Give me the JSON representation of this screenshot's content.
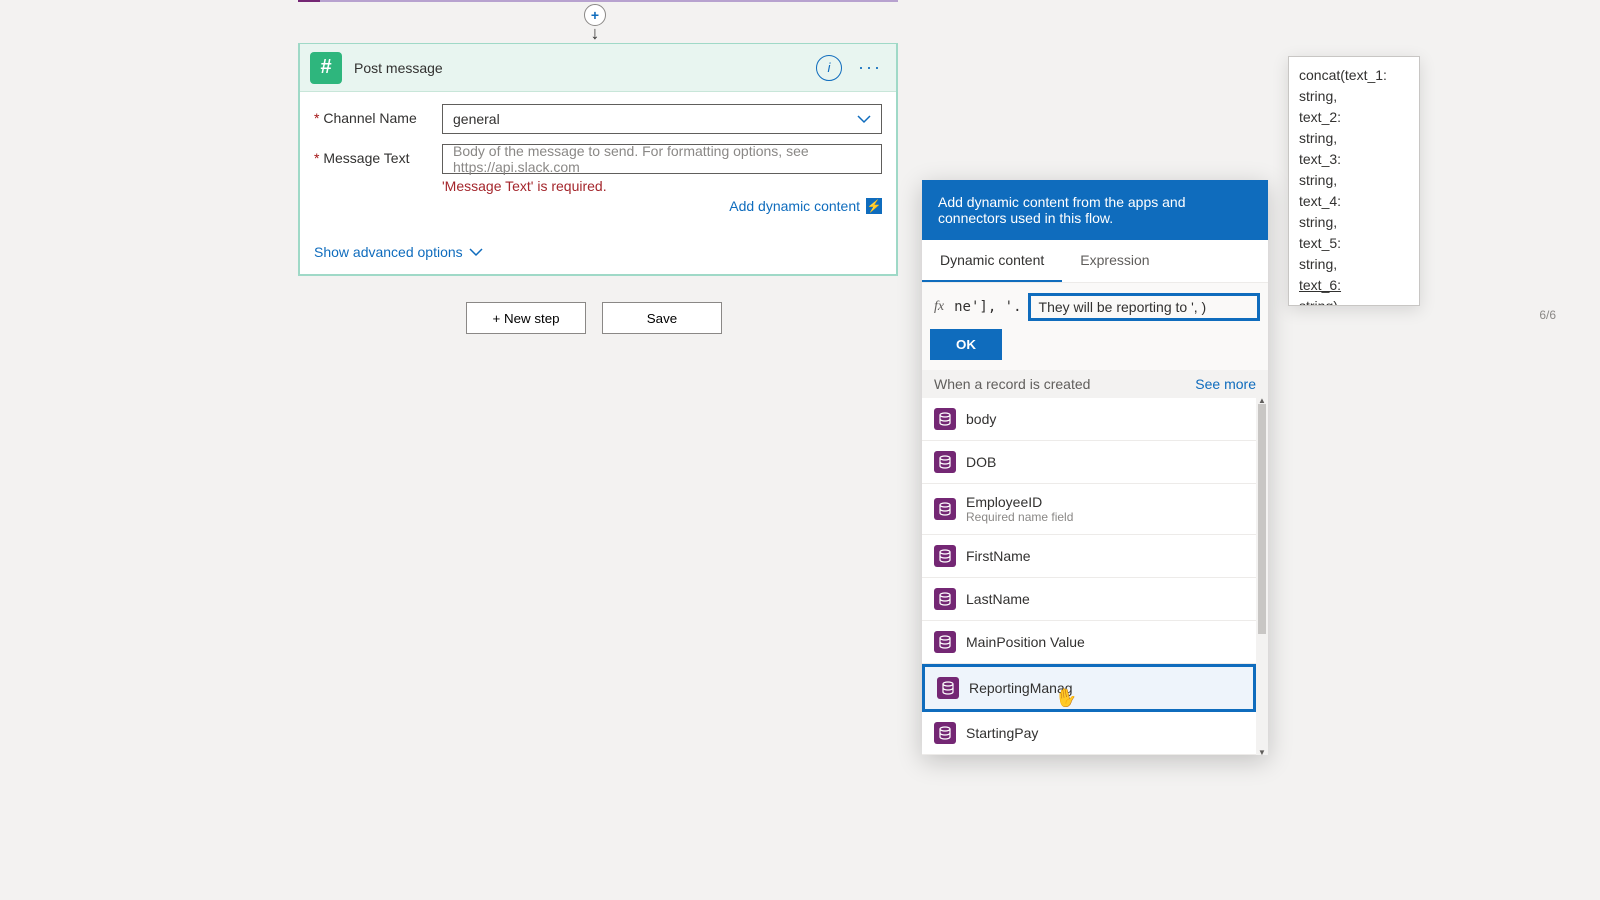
{
  "top": {
    "plus_label": "+"
  },
  "card": {
    "title": "Post message",
    "info_label": "i",
    "more_label": "···",
    "fields": {
      "channel_label": "Channel Name",
      "channel_value": "general",
      "messagetext_label": "Message Text",
      "messagetext_placeholder": "Body of the message to send. For formatting options, see https://api.slack.com",
      "messagetext_error": "'Message Text' is required."
    },
    "add_dynamic_label": "Add dynamic content",
    "show_advanced_label": "Show advanced options"
  },
  "buttons": {
    "new_step": "+ New step",
    "save": "Save"
  },
  "panel": {
    "header": "Add dynamic content from the apps and connectors used in this flow.",
    "tabs": {
      "dynamic": "Dynamic content",
      "expression": "Expression"
    },
    "pager": "6/6",
    "fx": "fx",
    "expr_left": "ne'], '.",
    "expr_value": "They will be reporting to ', )",
    "ok": "OK",
    "group_title": "When a record is created",
    "see_more": "See more",
    "items": [
      {
        "name": "body",
        "desc": ""
      },
      {
        "name": "DOB",
        "desc": ""
      },
      {
        "name": "EmployeeID",
        "desc": "Required name field"
      },
      {
        "name": "FirstName",
        "desc": ""
      },
      {
        "name": "LastName",
        "desc": ""
      },
      {
        "name": "MainPosition Value",
        "desc": ""
      },
      {
        "name": "ReportingManag",
        "desc": ""
      },
      {
        "name": "StartingPay",
        "desc": ""
      }
    ]
  },
  "tooltip": {
    "lines": [
      "concat(text_1:",
      "string,",
      "text_2:",
      "string,",
      "text_3:",
      "string,",
      "text_4:",
      "string,",
      "text_5:",
      "string,"
    ],
    "active": "text_6:",
    "tail": "string)"
  }
}
